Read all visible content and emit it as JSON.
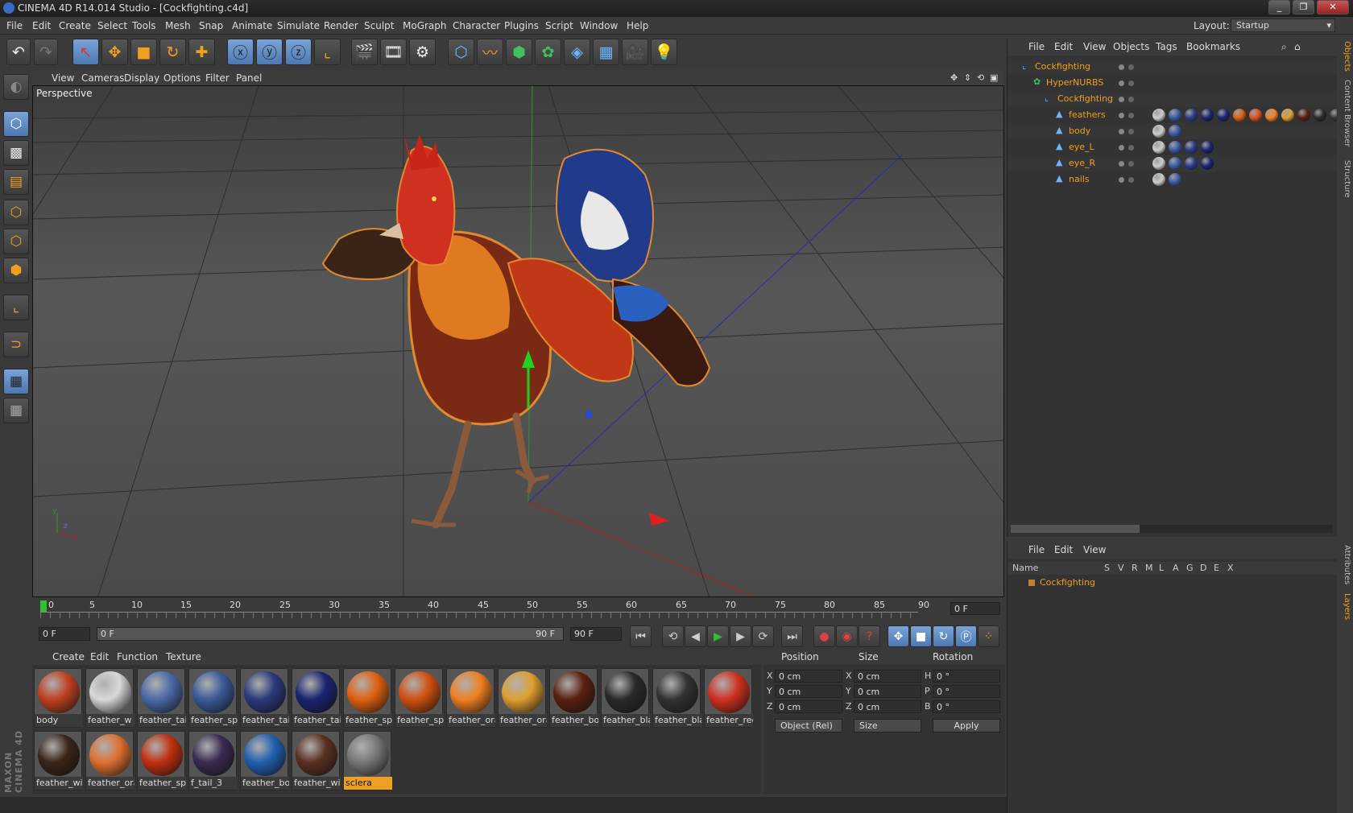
{
  "window": {
    "title": "CINEMA 4D R14.014 Studio - [Cockfighting.c4d]"
  },
  "menu": [
    "File",
    "Edit",
    "Create",
    "Select",
    "Tools",
    "Mesh",
    "Snap",
    "Animate",
    "Simulate",
    "Render",
    "Sculpt",
    "MoGraph",
    "Character",
    "Plugins",
    "Script",
    "Window",
    "Help"
  ],
  "layout": {
    "label": "Layout:",
    "value": "Startup"
  },
  "viewport": {
    "menu": [
      "View",
      "Cameras",
      "Display",
      "Options",
      "Filter",
      "Panel"
    ],
    "label": "Perspective"
  },
  "timeline": {
    "ticks": [
      "0",
      "5",
      "10",
      "15",
      "20",
      "25",
      "30",
      "35",
      "40",
      "45",
      "50",
      "55",
      "60",
      "65",
      "70",
      "75",
      "80",
      "85",
      "90"
    ],
    "frame": "0 F",
    "start": "0 F",
    "range_start": "0 F",
    "range_end": "90 F",
    "end": "90 F"
  },
  "materials": {
    "menu": [
      "Create",
      "Edit",
      "Function",
      "Texture"
    ],
    "items": [
      {
        "name": "body",
        "color": "#c04020"
      },
      {
        "name": "feather_w",
        "color": "#d8d8d8"
      },
      {
        "name": "feather_tai",
        "color": "#4a6aa8"
      },
      {
        "name": "feather_spi",
        "color": "#3a5a9a"
      },
      {
        "name": "feather_tai",
        "color": "#2a3a7a"
      },
      {
        "name": "feather_tai",
        "color": "#1a2470"
      },
      {
        "name": "feather_spi",
        "color": "#e06010"
      },
      {
        "name": "feather_spi",
        "color": "#d05010"
      },
      {
        "name": "feather_ora",
        "color": "#f08020"
      },
      {
        "name": "feather_ora",
        "color": "#e0a030"
      },
      {
        "name": "feather_bo",
        "color": "#5a2010"
      },
      {
        "name": "feather_bla",
        "color": "#2a2a2a"
      },
      {
        "name": "feather_bla",
        "color": "#333333"
      },
      {
        "name": "feather_rec",
        "color": "#d03020"
      },
      {
        "name": "feather_wi",
        "color": "#3a2418"
      },
      {
        "name": "feather_ora",
        "color": "#e07030"
      },
      {
        "name": "feather_spi",
        "color": "#c03010"
      },
      {
        "name": "f_tail_3",
        "color": "#3a2a50"
      },
      {
        "name": "feather_bo",
        "color": "#2060b0"
      },
      {
        "name": "feather_wi",
        "color": "#5a3020"
      },
      {
        "name": "sclera",
        "color": "#777777"
      }
    ]
  },
  "coords": {
    "headers": [
      "Position",
      "Size",
      "Rotation"
    ],
    "pos": {
      "x": "0 cm",
      "y": "0 cm",
      "z": "0 cm"
    },
    "size": {
      "x": "0 cm",
      "y": "0 cm",
      "z": "0 cm"
    },
    "rot": {
      "h": "0 °",
      "p": "0 °",
      "b": "0 °"
    },
    "mode": "Object (Rel)",
    "size_mode": "Size",
    "apply": "Apply"
  },
  "objects": {
    "menu": [
      "File",
      "Edit",
      "View",
      "Objects",
      "Tags",
      "Bookmarks"
    ],
    "rows": [
      {
        "name": "Cockfighting",
        "indent": 0
      },
      {
        "name": "HyperNURBS",
        "indent": 1
      },
      {
        "name": "Cockfighting",
        "indent": 2
      },
      {
        "name": "feathers",
        "indent": 3
      },
      {
        "name": "body",
        "indent": 3
      },
      {
        "name": "eye_L",
        "indent": 3
      },
      {
        "name": "eye_R",
        "indent": 3
      },
      {
        "name": "nails",
        "indent": 3
      }
    ]
  },
  "layers": {
    "menu": [
      "File",
      "Edit",
      "View"
    ],
    "columns": [
      "Name",
      "S",
      "V",
      "R",
      "M",
      "L",
      "A",
      "G",
      "D",
      "E",
      "X"
    ],
    "row": "Cockfighting"
  },
  "sidetabs": [
    "Objects",
    "Content Browser",
    "Structure",
    "Attributes",
    "Layers"
  ],
  "brand": "MAXON CINEMA 4D"
}
